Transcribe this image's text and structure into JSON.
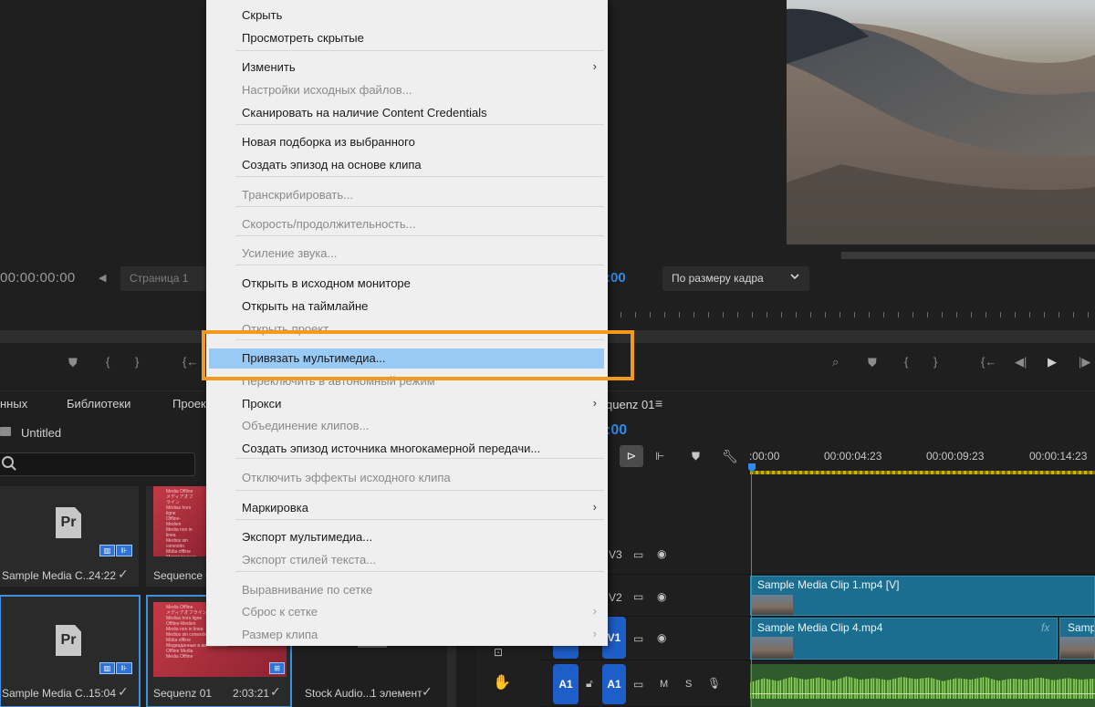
{
  "source_monitor": {
    "timecode": "00:00:00:00",
    "page_label": "Страница 1"
  },
  "program_monitor": {
    "timecode": ":00",
    "fit_option": "По размеру кадра"
  },
  "project_panel": {
    "tabs": [
      "нных",
      "Библиотеки",
      "Проек"
    ],
    "project_name": "Untitled",
    "items": [
      {
        "name": "Sample Media C...",
        "duration": "24:22"
      },
      {
        "name": "Sequence 0",
        "duration": ""
      },
      {
        "name": "Sample Media C...",
        "duration": "15:04"
      },
      {
        "name": "Sequenz 01",
        "duration": "2:03:21"
      },
      {
        "name": "Stock Audio...",
        "duration": "1 элемент"
      }
    ],
    "thumb_lines": [
      "Media Offline",
      "メディアオフライン",
      "Médias hors ligne",
      "Offline-Medien",
      "Media non in linea",
      "Medios sin conexión",
      "Mídia offline",
      "Медиаданные в автономном",
      "Offline Media",
      "Media Offline"
    ]
  },
  "timeline": {
    "tab_label": "quenz 01",
    "timecode": ":00",
    "ruler_ticks": [
      ":00:00",
      "00:00:04:23",
      "00:00:09:23",
      "00:00:14:23"
    ],
    "tracks": {
      "v3": "V3",
      "v2": "V2",
      "v1": "V1",
      "a1": "A1",
      "a1_target": "A1",
      "m": "M",
      "s": "S"
    },
    "clips": {
      "v2_clip": "Sample Media Clip 1.mp4 [V]",
      "v1_clip": "Sample Media Clip 4.mp4",
      "v1_clip_next": "Samp",
      "fx": "fx"
    }
  },
  "context_menu": {
    "items": [
      {
        "label": "Скрыть",
        "disabled": false,
        "submenu": false
      },
      {
        "label": "Просмотреть скрытые",
        "disabled": false,
        "submenu": false
      },
      {
        "label": "Изменить",
        "disabled": false,
        "submenu": true
      },
      {
        "label": "Настройки исходных файлов...",
        "disabled": true,
        "submenu": false
      },
      {
        "label": "Сканировать на наличие Content Credentials",
        "disabled": false,
        "submenu": false
      },
      {
        "label": "Новая подборка из выбранного",
        "disabled": false,
        "submenu": false
      },
      {
        "label": "Создать эпизод на основе клипа",
        "disabled": false,
        "submenu": false
      },
      {
        "label": "Транскрибировать...",
        "disabled": true,
        "submenu": false
      },
      {
        "label": "Скорость/продолжительность...",
        "disabled": true,
        "submenu": false
      },
      {
        "label": "Усиление звука...",
        "disabled": true,
        "submenu": false
      },
      {
        "label": "Открыть в исходном мониторе",
        "disabled": false,
        "submenu": false
      },
      {
        "label": "Открыть на таймлайне",
        "disabled": false,
        "submenu": false
      },
      {
        "label": "Открыть проект",
        "disabled": true,
        "submenu": false
      },
      {
        "label": "Привязать мультимедиа...",
        "disabled": false,
        "submenu": false,
        "highlighted": true
      },
      {
        "label": "Переключить в автономный режим",
        "disabled": true,
        "submenu": false
      },
      {
        "label": "Прокси",
        "disabled": false,
        "submenu": true
      },
      {
        "label": "Объединение клипов...",
        "disabled": true,
        "submenu": false
      },
      {
        "label": "Создать эпизод источника многокамерной передачи...",
        "disabled": false,
        "submenu": false
      },
      {
        "label": "Отключить эффекты исходного клипа",
        "disabled": true,
        "submenu": false
      },
      {
        "label": "Маркировка",
        "disabled": false,
        "submenu": true
      },
      {
        "label": "Экспорт мультимедиа...",
        "disabled": false,
        "submenu": false
      },
      {
        "label": "Экспорт стилей текста...",
        "disabled": true,
        "submenu": false
      },
      {
        "label": "Выравнивание по сетке",
        "disabled": true,
        "submenu": false
      },
      {
        "label": "Сброс к сетке",
        "disabled": true,
        "submenu": true
      },
      {
        "label": "Размер клипа",
        "disabled": true,
        "submenu": true
      }
    ],
    "submenu_glyph": "›"
  },
  "colors": {
    "accent_blue": "#2d8ceb",
    "highlight_orange": "#f39a1e",
    "menu_highlight": "#99c9f5"
  }
}
